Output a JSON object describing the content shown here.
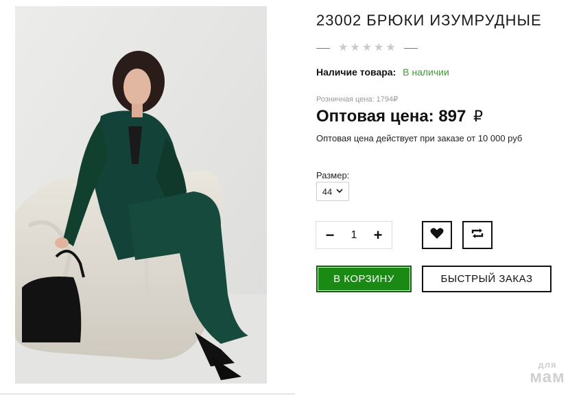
{
  "product": {
    "title": "23002 БРЮКИ ИЗУМРУДНЫЕ",
    "rating": {
      "value": 0,
      "max": 5,
      "star_color": "#c9c9c9"
    },
    "availability": {
      "label": "Наличие товара:",
      "value": "В наличии",
      "color": "#3e9a35"
    },
    "retail_price": "Розничная цена: 1794₽",
    "wholesale_price": {
      "label": "Оптовая цена:",
      "amount": "897",
      "currency": "₽"
    },
    "wholesale_note": "Оптовая цена действует при заказе от 10 000 руб",
    "size": {
      "label": "Размер:",
      "selected": "44"
    },
    "quantity": {
      "minus": "−",
      "value": "1",
      "plus": "+"
    },
    "icons": {
      "wishlist": "heart-icon",
      "compare": "compare-arrows-icon"
    },
    "buttons": {
      "cart": "В КОРЗИНУ",
      "quick_order": "БЫСТРЫЙ ЗАКАЗ"
    },
    "colors": {
      "accent_green": "#1a8a15",
      "suit_green": "#134338"
    }
  },
  "watermark": {
    "top": "для",
    "bottom": "мам"
  }
}
